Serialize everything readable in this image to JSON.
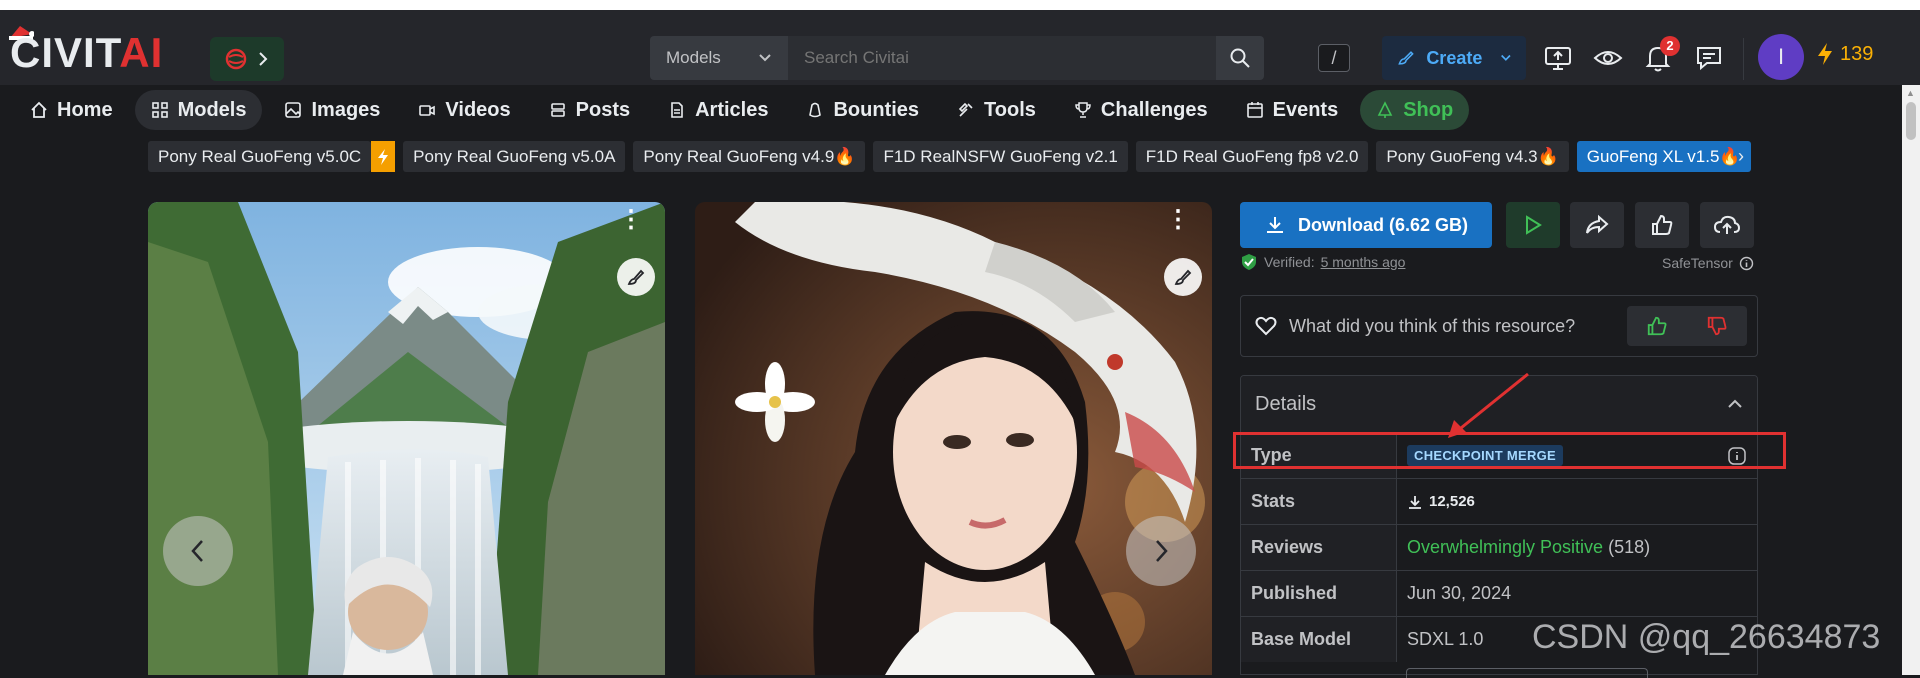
{
  "header": {
    "logo_main": "CIVIT",
    "logo_accent": "AI",
    "search": {
      "scope": "Models",
      "placeholder": "Search Civitai",
      "shortcut": "/"
    },
    "create_label": "Create",
    "notifications_count": "2",
    "avatar_initial": "I",
    "buzz_amount": "139"
  },
  "nav": {
    "items": [
      {
        "label": "Home",
        "icon": "home-icon"
      },
      {
        "label": "Models",
        "icon": "grid-icon"
      },
      {
        "label": "Images",
        "icon": "image-icon"
      },
      {
        "label": "Videos",
        "icon": "video-icon"
      },
      {
        "label": "Posts",
        "icon": "posts-icon"
      },
      {
        "label": "Articles",
        "icon": "article-icon"
      },
      {
        "label": "Bounties",
        "icon": "bounty-icon"
      },
      {
        "label": "Tools",
        "icon": "tools-icon"
      },
      {
        "label": "Challenges",
        "icon": "trophy-icon"
      },
      {
        "label": "Events",
        "icon": "calendar-icon"
      },
      {
        "label": "Shop",
        "icon": "shop-icon"
      }
    ],
    "active": "Models"
  },
  "version_tabs": [
    "Pony Real GuoFeng v5.0C",
    "Pony Real GuoFeng v5.0A",
    "Pony Real GuoFeng v4.9🔥",
    "F1D RealNSFW GuoFeng v2.1",
    "F1D Real GuoFeng fp8 v2.0",
    "Pony GuoFeng v4.3🔥",
    "GuoFeng XL v1.5🔥"
  ],
  "download": {
    "label": "Download (6.62 GB)",
    "verified_label": "Verified:",
    "verified_when": "5 months ago",
    "file_format": "SafeTensor"
  },
  "feedback": {
    "question": "What did you think of this resource?"
  },
  "details": {
    "title": "Details",
    "rows": {
      "type_key": "Type",
      "type_value": "CHECKPOINT MERGE",
      "stats_key": "Stats",
      "stats_downloads": "12,526",
      "reviews_key": "Reviews",
      "reviews_value": "Overwhelmingly Positive",
      "reviews_count": "(518)",
      "published_key": "Published",
      "published_value": "Jun 30, 2024",
      "base_model_key": "Base Model",
      "base_model_value": "SDXL 1.0"
    }
  },
  "watermark": "CSDN @qq_26634873",
  "colors": {
    "accent": "#1971c2",
    "highlight": "#e03131",
    "positive": "#40c057",
    "buzz": "#fab005"
  }
}
